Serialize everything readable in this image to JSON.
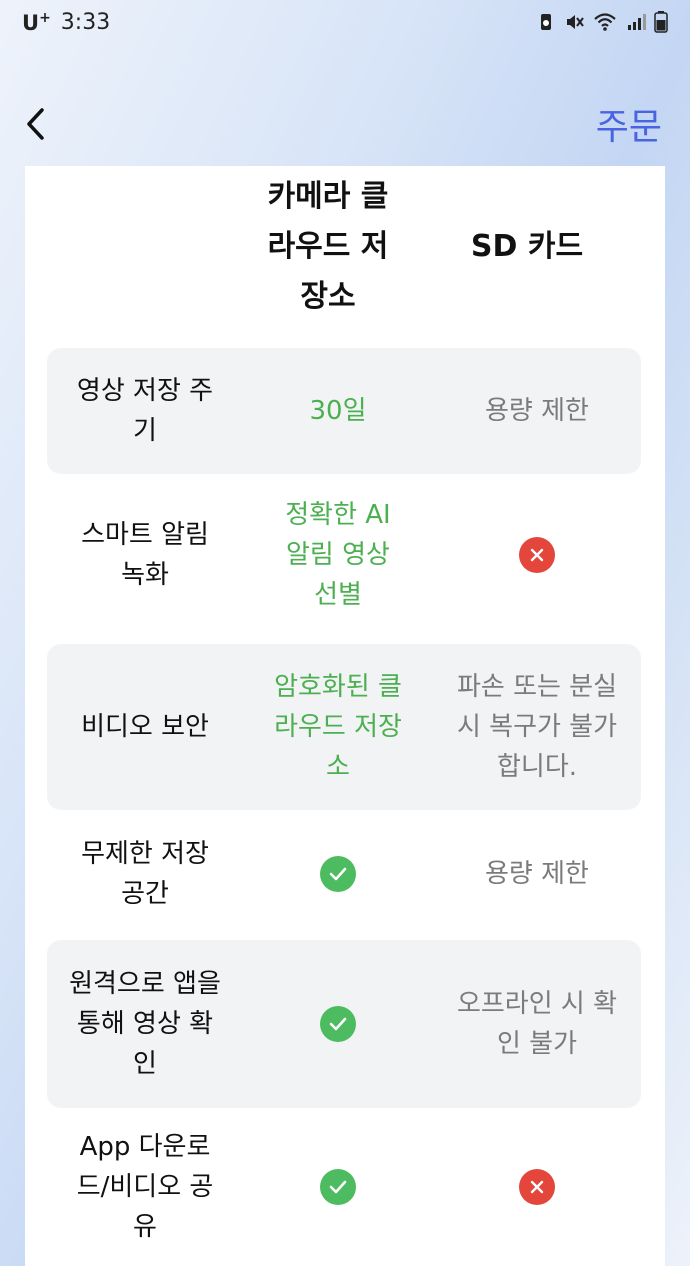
{
  "status_bar": {
    "carrier": "U",
    "carrier_sup": "+",
    "time": "3:33"
  },
  "nav": {
    "order_label": "주문"
  },
  "table": {
    "head_cloud": [
      "카메라 클",
      "라우드 저",
      "장소"
    ],
    "head_sd": "SD 카드",
    "rows": [
      {
        "feature": [
          "영상 저장 주",
          "기"
        ],
        "cloud": [
          "30일"
        ],
        "sd": [
          "용량 제한"
        ]
      },
      {
        "feature": [
          "스마트 알림",
          "녹화"
        ],
        "cloud": [
          "정확한 AI",
          "알림 영상",
          "선별"
        ],
        "sd_icon": "cross-icon"
      },
      {
        "feature": [
          "비디오 보안"
        ],
        "cloud": [
          "암호화된 클",
          "라우드 저장",
          "소"
        ],
        "sd": [
          "파손 또는 분실",
          "시 복구가 불가",
          "합니다."
        ]
      },
      {
        "feature": [
          "무제한 저장",
          "공간"
        ],
        "cloud_icon": "check-icon",
        "sd": [
          "용량 제한"
        ]
      },
      {
        "feature": [
          "원격으로 앱을",
          "통해 영상 확",
          "인"
        ],
        "cloud_icon": "check-icon",
        "sd": [
          "오프라인 시 확",
          "인 불가"
        ]
      },
      {
        "feature": [
          "App 다운로",
          "드/비디오 공",
          "유"
        ],
        "cloud_icon": "check-icon",
        "sd_icon": "cross-icon"
      }
    ]
  },
  "colors": {
    "accent": "#4a63e0",
    "positive": "#4caf50",
    "check_bg": "#4dbb5f",
    "cross_bg": "#e4463c",
    "muted": "#7b7b7b",
    "row_shade": "#f2f3f5"
  }
}
